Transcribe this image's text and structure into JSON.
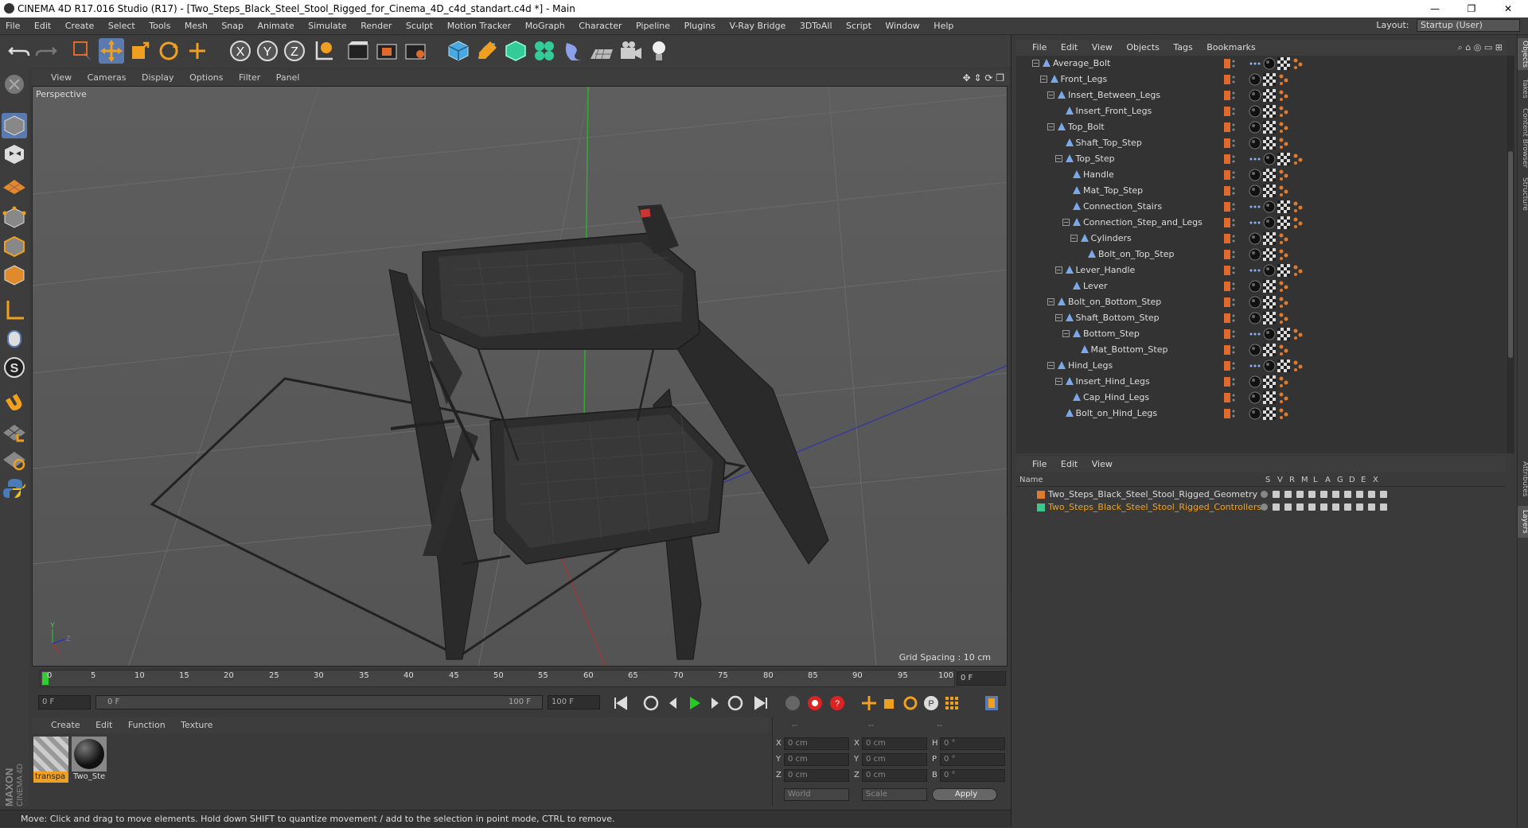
{
  "window": {
    "title": "CINEMA 4D R17.016 Studio (R17) - [Two_Steps_Black_Steel_Stool_Rigged_for_Cinema_4D_c4d_standart.c4d *] - Main",
    "controls": [
      "—",
      "❐",
      "✕"
    ]
  },
  "menubar": {
    "items": [
      "File",
      "Edit",
      "Create",
      "Select",
      "Tools",
      "Mesh",
      "Snap",
      "Animate",
      "Simulate",
      "Render",
      "Sculpt",
      "Motion Tracker",
      "MoGraph",
      "Character",
      "Pipeline",
      "Plugins",
      "V-Ray Bridge",
      "3DToAll",
      "Script",
      "Window",
      "Help"
    ],
    "layout_label": "Layout:",
    "layout_value": "Startup (User)"
  },
  "toolbar": {
    "icons": [
      "undo-icon",
      "redo-icon",
      "live-selection-icon",
      "move-icon",
      "scale-icon",
      "rotate-icon",
      "move-tool-icon",
      "x-axis-icon",
      "y-axis-icon",
      "z-axis-icon",
      "world-coordinates-icon",
      "render-view-icon",
      "render-region-icon",
      "render-settings-icon",
      "cube-icon",
      "pen-icon",
      "subdivision-icon",
      "cloner-icon",
      "deformer-icon",
      "floor-icon",
      "camera-icon",
      "light-icon"
    ],
    "axis_letters": [
      "X",
      "Y",
      "Z"
    ]
  },
  "left_tools": {
    "icons": [
      "make-editable-icon",
      "model-mode-icon",
      "texture-mode-icon",
      "workplane-icon",
      "points-mode-icon",
      "edges-mode-icon",
      "polygons-mode-icon",
      "axis-mode-icon",
      "tweak-icon",
      "snap-icon",
      "magnet-icon",
      "grid-snap-icon",
      "workplane-lock-icon",
      "python-icon"
    ],
    "snap_letter": "S"
  },
  "viewport": {
    "menu": [
      "View",
      "Cameras",
      "Display",
      "Options",
      "Filter",
      "Panel"
    ],
    "label": "Perspective",
    "grid_spacing": "Grid Spacing : 10 cm",
    "axis_labels": [
      "Y",
      "Z"
    ]
  },
  "timeline": {
    "ticks": [
      "0",
      "5",
      "10",
      "15",
      "20",
      "25",
      "30",
      "35",
      "40",
      "45",
      "50",
      "55",
      "60",
      "65",
      "70",
      "75",
      "80",
      "85",
      "90",
      "95",
      "100"
    ],
    "current_frame": "0 F",
    "start_field": "0 F",
    "range_start": "0 F",
    "range_end": "100 F",
    "end_field": "100 F"
  },
  "materials": {
    "menu": [
      "Create",
      "Edit",
      "Function",
      "Texture"
    ],
    "items": [
      {
        "label": "transpa"
      },
      {
        "label": "Two_Ste"
      }
    ]
  },
  "coordinates": {
    "header": [
      "--",
      "--",
      "--"
    ],
    "rows": [
      {
        "a": "X",
        "av": "0 cm",
        "b": "X",
        "bv": "0 cm",
        "c": "H",
        "cv": "0 °"
      },
      {
        "a": "Y",
        "av": "0 cm",
        "b": "Y",
        "bv": "0 cm",
        "c": "P",
        "cv": "0 °"
      },
      {
        "a": "Z",
        "av": "0 cm",
        "b": "Z",
        "bv": "0 cm",
        "c": "B",
        "cv": "0 °"
      }
    ],
    "mode1": "World",
    "mode2": "Scale",
    "apply": "Apply"
  },
  "status": "Move: Click and drag to move elements. Hold down SHIFT to quantize movement / add to the selection in point mode, CTRL to remove.",
  "maxon": {
    "brand": "MAXON",
    "product": "CINEMA 4D"
  },
  "objects": {
    "menu": [
      "File",
      "Edit",
      "View",
      "Objects",
      "Tags",
      "Bookmarks"
    ],
    "rows": [
      {
        "name": "Average_Bolt",
        "depth": 3,
        "exp": "−"
      },
      {
        "name": "Front_Legs",
        "depth": 4,
        "exp": "−"
      },
      {
        "name": "Insert_Between_Legs",
        "depth": 5,
        "exp": "−"
      },
      {
        "name": "Insert_Front_Legs",
        "depth": 6,
        "exp": ""
      },
      {
        "name": "Top_Bolt",
        "depth": 5,
        "exp": "−"
      },
      {
        "name": "Shaft_Top_Step",
        "depth": 6,
        "exp": ""
      },
      {
        "name": "Top_Step",
        "depth": 6,
        "exp": "−"
      },
      {
        "name": "Handle",
        "depth": 7,
        "exp": ""
      },
      {
        "name": "Mat_Top_Step",
        "depth": 7,
        "exp": ""
      },
      {
        "name": "Connection_Stairs",
        "depth": 7,
        "exp": ""
      },
      {
        "name": "Connection_Step_and_Legs",
        "depth": 7,
        "exp": "−"
      },
      {
        "name": "Cylinders",
        "depth": 8,
        "exp": "−"
      },
      {
        "name": "Bolt_on_Top_Step",
        "depth": 9,
        "exp": ""
      },
      {
        "name": "Lever_Handle",
        "depth": 6,
        "exp": "−"
      },
      {
        "name": "Lever",
        "depth": 7,
        "exp": ""
      },
      {
        "name": "Bolt_on_Bottom_Step",
        "depth": 5,
        "exp": "−"
      },
      {
        "name": "Shaft_Bottom_Step",
        "depth": 6,
        "exp": "−"
      },
      {
        "name": "Bottom_Step",
        "depth": 7,
        "exp": "−"
      },
      {
        "name": "Mat_Bottom_Step",
        "depth": 8,
        "exp": ""
      },
      {
        "name": "Hind_Legs",
        "depth": 5,
        "exp": "−"
      },
      {
        "name": "Insert_Hind_Legs",
        "depth": 6,
        "exp": "−"
      },
      {
        "name": "Cap_Hind_Legs",
        "depth": 7,
        "exp": ""
      },
      {
        "name": "Bolt_on_Hind_Legs",
        "depth": 6,
        "exp": ""
      }
    ]
  },
  "layers": {
    "menu": [
      "File",
      "Edit",
      "View"
    ],
    "columns": [
      "Name",
      "S",
      "V",
      "R",
      "M",
      "L",
      "A",
      "G",
      "D",
      "E",
      "X"
    ],
    "items": [
      {
        "name": "Two_Steps_Black_Steel_Stool_Rigged_Geometry",
        "color": "#e07a2c",
        "text_color": "#dddddd"
      },
      {
        "name": "Two_Steps_Black_Steel_Stool_Rigged_Controllers",
        "color": "#3cc98a",
        "text_color": "#f0a020"
      }
    ]
  },
  "side_tabs": [
    "Objects",
    "Takes",
    "Content Browser",
    "Structure",
    "Attributes",
    "Layers"
  ],
  "colors": {
    "accent_orange": "#e06a2c",
    "selected_tab": "#5a7ab0",
    "play_green": "#22cc22",
    "record_red": "#dd2222"
  }
}
